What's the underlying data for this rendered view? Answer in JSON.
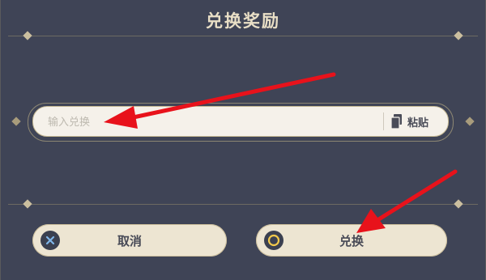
{
  "dialog": {
    "title": "兑换奖励"
  },
  "code_field": {
    "placeholder": "输入兑换",
    "paste_label": "粘贴"
  },
  "buttons": {
    "cancel_label": "取消",
    "confirm_label": "兑换"
  },
  "colors": {
    "background": "#3f4456",
    "title": "#e9dfc6",
    "button_fill": "#ede5d2",
    "arrow": "#e8121b"
  },
  "icons": {
    "paste": "clipboard-icon",
    "cancel": "x-close-icon",
    "confirm": "circle-confirm-icon"
  }
}
